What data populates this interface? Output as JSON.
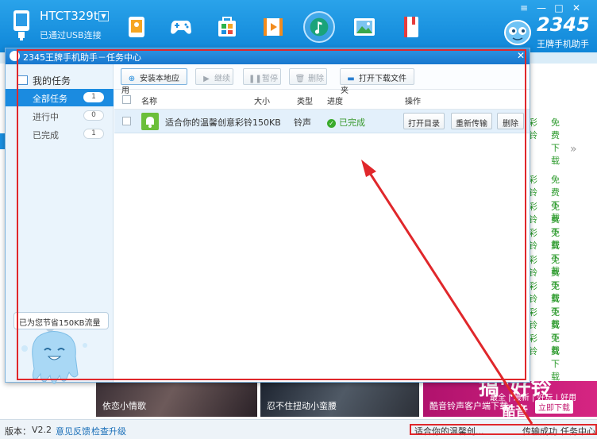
{
  "header": {
    "device_name": "HTCT329t",
    "connection": "已通过USB连接",
    "dropdown": "▼",
    "nav_icons": [
      "contacts-icon",
      "games-icon",
      "apps-icon",
      "video-icon",
      "music-icon",
      "wallpaper-icon",
      "ebook-icon"
    ],
    "window_controls": {
      "menu": "≡",
      "min": "—",
      "max": "□",
      "close": "✕"
    },
    "brand": {
      "name": "2345",
      "tagline": "王牌手机助手"
    },
    "accent": "#1a8fe0"
  },
  "background": {
    "rows": [
      {
        "a": "彩铃",
        "b": "免费下载"
      },
      {
        "a": "彩铃",
        "b": "免费下载"
      },
      {
        "a": "彩铃",
        "b": "免费下载"
      },
      {
        "a": "彩铃",
        "b": "免费下载"
      },
      {
        "a": "彩铃",
        "b": "免费下载"
      },
      {
        "a": "彩铃",
        "b": "免费下载"
      },
      {
        "a": "彩铃",
        "b": "免费下载"
      },
      {
        "a": "彩铃",
        "b": "免费下载"
      }
    ],
    "more": "»",
    "banners": [
      {
        "caption": "依恋小情歌"
      },
      {
        "caption": "忍不住扭动小蛮腰"
      },
      {
        "caption": "酷音铃声客户端下载",
        "headline": "搞\"好铃",
        "sub": "酷音",
        "tags": "最全 | 最新 | 好玩 | 好用",
        "download": "立即下载"
      }
    ]
  },
  "status_bar": {
    "version_label": "版本：",
    "version": "V2.2",
    "feedback": "意见反馈",
    "upgrade": "检查升级",
    "transfer_item": "适合你的温馨创...",
    "transfer_state": "传输成功",
    "task_center": "任务中心"
  },
  "dialog": {
    "title": "2345王牌手机助手－任务中心",
    "close": "✕",
    "sidebar": {
      "heading": "我的任务",
      "items": [
        {
          "label": "全部任务",
          "count": "1"
        },
        {
          "label": "进行中",
          "count": "0"
        },
        {
          "label": "已完成",
          "count": "1"
        }
      ],
      "bubble": "已为您节省150KB流量"
    },
    "toolbar": {
      "install": "安装本地应用",
      "resume": "继续",
      "pause": "暂停",
      "delete": "删除",
      "open_folder": "打开下载文件夹"
    },
    "columns": {
      "name": "名称",
      "size": "大小",
      "type": "类型",
      "progress": "进度",
      "action": "操作"
    },
    "rows": [
      {
        "name": "适合你的温馨创意彩铃",
        "size": "150KB",
        "type": "铃声",
        "progress": "已完成",
        "actions": {
          "open_dir": "打开目录",
          "retransfer": "重新传输",
          "delete": "删除"
        }
      }
    ]
  }
}
